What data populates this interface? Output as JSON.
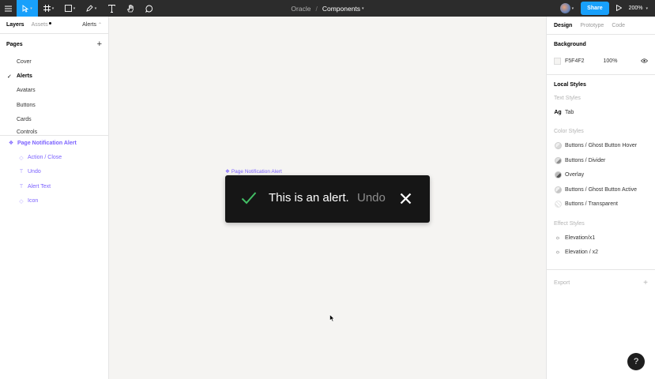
{
  "toolbar": {
    "project": "Oracle",
    "separator": "/",
    "file": "Components",
    "share_label": "Share",
    "zoom": "200%"
  },
  "left_panel": {
    "tabs": [
      "Layers",
      "Assets"
    ],
    "current_page": "Alerts",
    "pages_title": "Pages",
    "pages": [
      "Cover",
      "Alerts",
      "Avatars",
      "Buttons",
      "Cards",
      "Controls"
    ],
    "layers": [
      {
        "name": "Page Notification Alert",
        "icon": "component-icon"
      },
      {
        "name": "Action / Close",
        "icon": "instance-icon"
      },
      {
        "name": "Undo",
        "icon": "text-icon"
      },
      {
        "name": "Alert Text",
        "icon": "text-icon"
      },
      {
        "name": "Icon",
        "icon": "instance-icon"
      }
    ]
  },
  "canvas": {
    "frame_label": "Page Notification Alert",
    "alert_text": "This is an alert.",
    "alert_undo": "Undo",
    "background": "#F5F4F2"
  },
  "right_panel": {
    "tabs": [
      "Design",
      "Prototype",
      "Code"
    ],
    "background_title": "Background",
    "background_hex": "F5F4F2",
    "background_opacity": "100%",
    "local_styles_title": "Local Styles",
    "text_styles_title": "Text Styles",
    "text_styles": [
      "Tab"
    ],
    "color_styles_title": "Color Styles",
    "color_styles": [
      "Buttons / Ghost Button Hover",
      "Buttons / Divider",
      "Overlay",
      "Buttons / Ghost Button Active",
      "Buttons / Transparent"
    ],
    "effect_styles_title": "Effect Styles",
    "effect_styles": [
      "Elevation/x1",
      "Elevation / x2"
    ],
    "export_title": "Export"
  },
  "help_label": "?",
  "colors": {
    "accent": "#18a0fb",
    "component": "#7b61ff",
    "toolbar": "#2c2c2c",
    "alert_bg": "#161616",
    "alert_check": "#42be65"
  }
}
